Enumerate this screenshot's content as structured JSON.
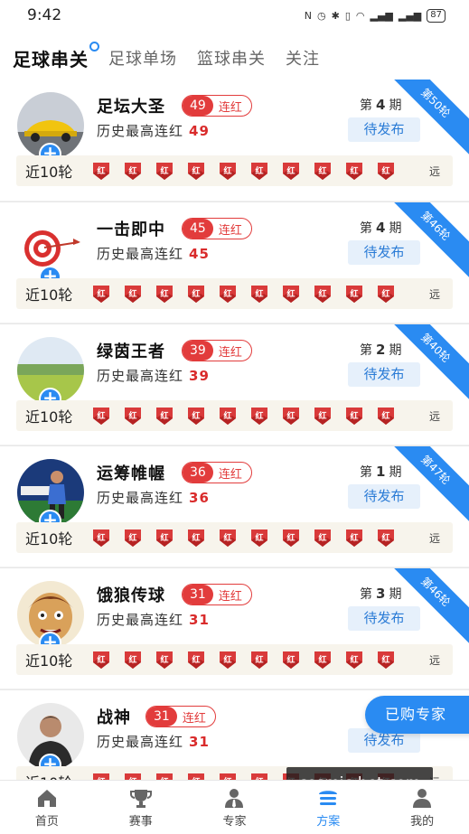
{
  "status": {
    "time": "9:42",
    "battery": "87"
  },
  "tabs": [
    {
      "label": "足球串关",
      "active": true
    },
    {
      "label": "足球单场",
      "active": false
    },
    {
      "label": "篮球串关",
      "active": false
    },
    {
      "label": "关注",
      "active": false
    }
  ],
  "common": {
    "streak_label": "连红",
    "history_label": "历史最高连红",
    "period_prefix": "第",
    "period_suffix": "期",
    "pending_label": "待发布",
    "recent_label": "近10轮",
    "red_badge": "红",
    "far_label": "远"
  },
  "experts": [
    {
      "name": "足坛大圣",
      "streak": "49",
      "history_max": "49",
      "period": "4",
      "ribbon": "第50轮",
      "avatar": "car"
    },
    {
      "name": "一击即中",
      "streak": "45",
      "history_max": "45",
      "period": "4",
      "ribbon": "第46轮",
      "avatar": "target"
    },
    {
      "name": "绿茵王者",
      "streak": "39",
      "history_max": "39",
      "period": "2",
      "ribbon": "第40轮",
      "avatar": "field"
    },
    {
      "name": "运筹帷幄",
      "streak": "36",
      "history_max": "36",
      "period": "1",
      "ribbon": "第47轮",
      "avatar": "player"
    },
    {
      "name": "饿狼传球",
      "streak": "31",
      "history_max": "31",
      "period": "3",
      "ribbon": "第46轮",
      "avatar": "face"
    },
    {
      "name": "战神",
      "streak": "31",
      "history_max": "31",
      "period": "",
      "ribbon": "",
      "avatar": "man"
    }
  ],
  "floating": {
    "bought_label": "已购专家",
    "watermark": "cosmic-bet.com"
  },
  "nav": [
    {
      "label": "首页",
      "icon": "home-icon",
      "active": false
    },
    {
      "label": "赛事",
      "icon": "trophy-icon",
      "active": false
    },
    {
      "label": "专家",
      "icon": "expert-icon",
      "active": false
    },
    {
      "label": "方案",
      "icon": "plan-icon",
      "active": true
    },
    {
      "label": "我的",
      "icon": "profile-icon",
      "active": false
    }
  ],
  "colors": {
    "accent": "#2a8bf2",
    "red": "#e23c3c"
  }
}
